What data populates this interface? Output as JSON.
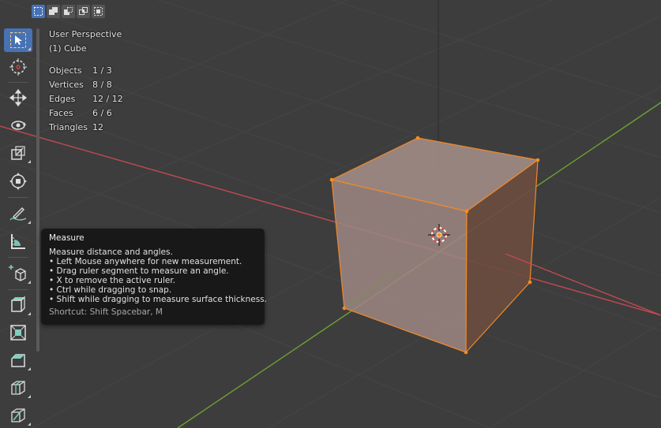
{
  "viewport": {
    "perspective_label": "User Perspective",
    "object_label": "(1) Cube"
  },
  "stats": [
    {
      "label": "Objects",
      "value": "1 / 3"
    },
    {
      "label": "Vertices",
      "value": "8 / 8"
    },
    {
      "label": "Edges",
      "value": "12 / 12"
    },
    {
      "label": "Faces",
      "value": "6 / 6"
    },
    {
      "label": "Triangles",
      "value": "12"
    }
  ],
  "selection_modes": [
    "select-new-icon",
    "select-extend-icon",
    "select-subtract-icon",
    "select-intersect-icon",
    "select-invert-icon"
  ],
  "toolbar": {
    "tools": [
      {
        "name": "select-box-tool",
        "icon": "cursor-icon",
        "active": true
      },
      {
        "name": "cursor-tool",
        "icon": "3d-cursor-icon"
      },
      {
        "name": "move-tool",
        "icon": "move-arrows-icon"
      },
      {
        "name": "rotate-tool",
        "icon": "rotate-icon"
      },
      {
        "name": "scale-tool",
        "icon": "scale-icon"
      },
      {
        "name": "transform-tool",
        "icon": "transform-icon"
      },
      {
        "name": "annotate-tool",
        "icon": "pencil-icon"
      },
      {
        "name": "measure-tool",
        "icon": "ruler-icon"
      },
      {
        "name": "add-cube-tool",
        "icon": "add-cube-icon"
      },
      {
        "name": "extrude-tool",
        "icon": "extrude-icon"
      },
      {
        "name": "inset-tool",
        "icon": "inset-icon"
      },
      {
        "name": "bevel-tool",
        "icon": "bevel-icon"
      },
      {
        "name": "loop-cut-tool",
        "icon": "loop-cut-icon"
      },
      {
        "name": "knife-tool",
        "icon": "knife-icon"
      }
    ]
  },
  "tooltip": {
    "title": "Measure",
    "lines": [
      "Measure distance and angles.",
      "• Left Mouse anywhere for new measurement.",
      "• Drag ruler segment to measure an angle.",
      "• X to remove the active ruler.",
      "• Ctrl while dragging to snap.",
      "• Shift while dragging to measure surface thickness."
    ],
    "shortcut": "Shortcut: Shift Spacebar, M"
  },
  "colors": {
    "background": "#3d3d3d",
    "x_axis": "#c24a52",
    "y_axis": "#6fa033",
    "selection_outline": "#f0882a",
    "active_tool": "#4772b3"
  }
}
